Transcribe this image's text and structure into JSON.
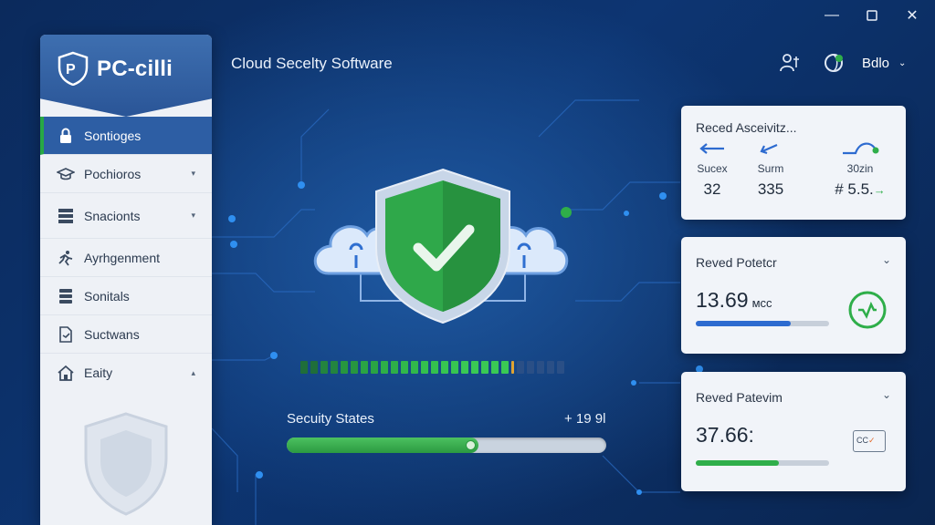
{
  "window": {
    "minimize_icon": "minimize-icon",
    "maximize_icon": "maximize-icon",
    "close_icon": "close-icon"
  },
  "brand": {
    "name": "PC-cilli",
    "logo_text": "P"
  },
  "app_title": "Cloud Secelty Software",
  "header": {
    "user_name": "Bdlo",
    "caret": "⌄"
  },
  "sidebar": {
    "items": [
      {
        "label": "Sontioges",
        "icon": "lock-icon",
        "active": true
      },
      {
        "label": "Pochioros",
        "icon": "hat-icon",
        "chevron": "▾"
      },
      {
        "label": "Snacionts",
        "icon": "server-icon",
        "chevron": "▾"
      },
      {
        "label": "Ayrhgenment",
        "icon": "runner-icon"
      },
      {
        "label": "Sonitals",
        "icon": "database-icon"
      },
      {
        "label": "Suctwans",
        "icon": "document-icon"
      },
      {
        "label": "Eaity",
        "icon": "home-icon",
        "chevron": "▴"
      }
    ]
  },
  "security": {
    "label": "Secuity States",
    "value": "+ 19 9l",
    "progress": 0.6
  },
  "cards": {
    "card1": {
      "title": "Reced Asceivitz...",
      "stats": [
        {
          "label": "Sucex",
          "value": "32"
        },
        {
          "label": "Surm",
          "value": "335"
        },
        {
          "label": "30zin",
          "value": "# 5.5.",
          "suffix": "→"
        }
      ]
    },
    "card2": {
      "title": "Reved Potetcr",
      "chevron": "⌄",
      "value": "13.69",
      "unit": "мcc",
      "progress": 0.71
    },
    "card3": {
      "title": "Reved Patevim",
      "chevron": "⌄",
      "value": "37.66:",
      "badge": "CC",
      "progress": 0.62
    }
  },
  "colors": {
    "accent_green": "#2fae4a",
    "accent_blue": "#2d6bd0",
    "bg_dark": "#0b2a5c"
  }
}
